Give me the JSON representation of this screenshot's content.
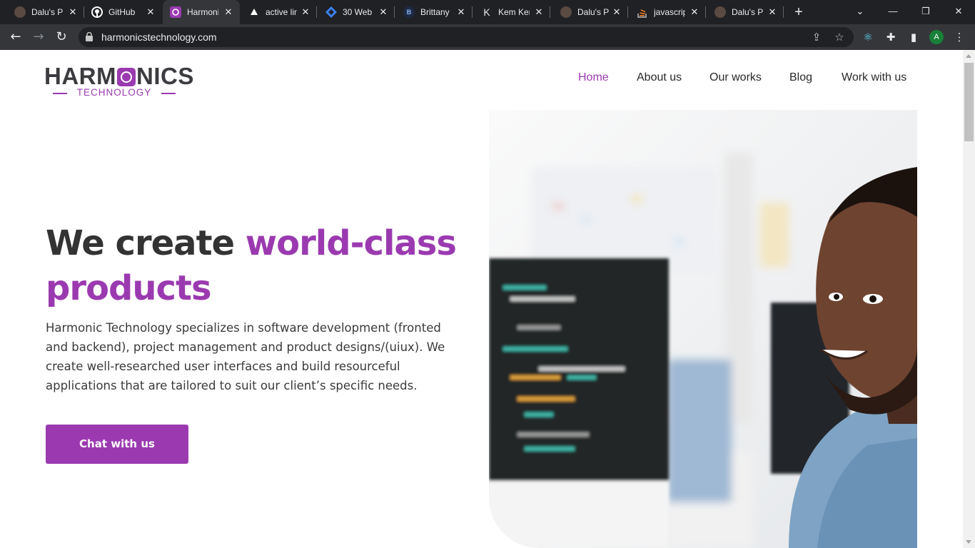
{
  "browser": {
    "tabs": [
      {
        "title": "Dalu's Pe",
        "icon": "person-favicon"
      },
      {
        "title": "GitHub",
        "icon": "github-icon"
      },
      {
        "title": "Harmoni",
        "icon": "harmonics-favicon",
        "active": true
      },
      {
        "title": "active lin",
        "icon": "triangle-favicon"
      },
      {
        "title": "30 Web",
        "icon": "diamond-favicon"
      },
      {
        "title": "Brittany",
        "icon": "b-favicon"
      },
      {
        "title": "Kem Ken",
        "icon": "k-favicon"
      },
      {
        "title": "Dalu's Pe",
        "icon": "person-favicon"
      },
      {
        "title": "javascrip",
        "icon": "stack-favicon"
      },
      {
        "title": "Dalu's Pe",
        "icon": "person-favicon"
      }
    ],
    "new_tab": "+",
    "url": "harmonicstechnology.com",
    "profile_initial": "A"
  },
  "site": {
    "logo_word": [
      "HARM",
      "NICS"
    ],
    "logo_sub": "TECHNOLOGY",
    "nav": [
      "Home",
      "About us",
      "Our works",
      "Blog",
      "Work with us"
    ],
    "headline_dark": "We create ",
    "headline_accent": "world-class products",
    "lead": "Harmonic Technology specializes in software development (fronted and backend), project management and product designs/(uiux). We create well-researched user interfaces and build resourceful applications that are tailored to suit our client’s specific needs.",
    "cta": "Chat with us"
  },
  "colors": {
    "brand_purple": "#9b3ab0",
    "text_dark": "#333333",
    "chrome_dark": "#202124",
    "chrome_mid": "#35363a"
  }
}
